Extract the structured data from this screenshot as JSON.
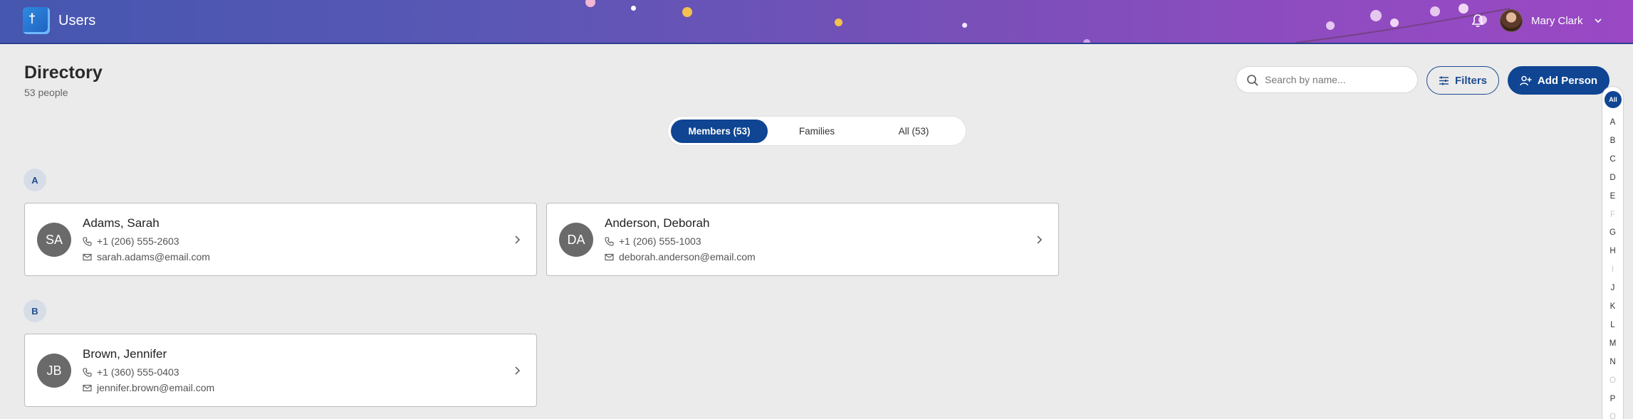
{
  "header": {
    "app_title": "Users",
    "logo_icon": "app-logo-icon",
    "logo_mark": "†",
    "user_name": "Mary Clark"
  },
  "page": {
    "title": "Directory",
    "count": "53 people"
  },
  "toolbar": {
    "search_placeholder": "Search by name...",
    "filters_label": "Filters",
    "add_label": "Add Person"
  },
  "tabs": [
    {
      "label": "Members (53)",
      "active": true
    },
    {
      "label": "Families",
      "active": false
    },
    {
      "label": "All (53)",
      "active": false
    }
  ],
  "groups": [
    {
      "letter": "A",
      "people": [
        {
          "initials": "SA",
          "name": "Adams, Sarah",
          "phone": "+1 (206) 555-2603",
          "email": "sarah.adams@email.com"
        },
        {
          "initials": "DA",
          "name": "Anderson, Deborah",
          "phone": "+1 (206) 555-1003",
          "email": "deborah.anderson@email.com"
        }
      ]
    },
    {
      "letter": "B",
      "people": [
        {
          "initials": "JB",
          "name": "Brown, Jennifer",
          "phone": "+1 (360) 555-0403",
          "email": "jennifer.brown@email.com"
        }
      ]
    }
  ],
  "alpha_index": {
    "all_label": "All",
    "letters": [
      {
        "l": "A",
        "enabled": true
      },
      {
        "l": "B",
        "enabled": true
      },
      {
        "l": "C",
        "enabled": true
      },
      {
        "l": "D",
        "enabled": true
      },
      {
        "l": "E",
        "enabled": true
      },
      {
        "l": "F",
        "enabled": false
      },
      {
        "l": "G",
        "enabled": true
      },
      {
        "l": "H",
        "enabled": true
      },
      {
        "l": "I",
        "enabled": false
      },
      {
        "l": "J",
        "enabled": true
      },
      {
        "l": "K",
        "enabled": true
      },
      {
        "l": "L",
        "enabled": true
      },
      {
        "l": "M",
        "enabled": true
      },
      {
        "l": "N",
        "enabled": true
      },
      {
        "l": "O",
        "enabled": false
      },
      {
        "l": "P",
        "enabled": true
      },
      {
        "l": "Q",
        "enabled": false
      }
    ]
  },
  "colors": {
    "primary": "#0f4592",
    "avatar_bg": "#6a6a6a",
    "page_bg": "#ebebeb"
  }
}
